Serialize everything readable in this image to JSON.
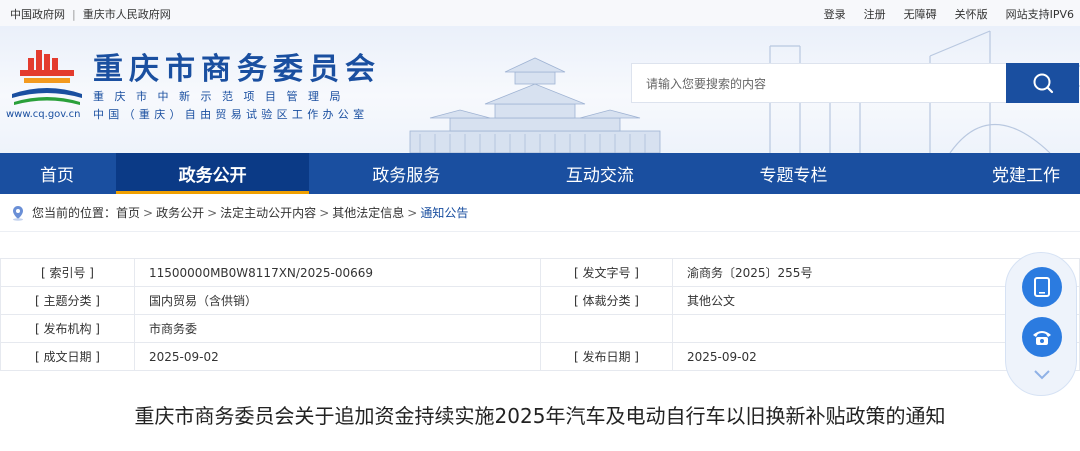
{
  "topbar": {
    "links_left": [
      "中国政府网",
      "重庆市人民政府网"
    ],
    "links_right": [
      "登录",
      "注册",
      "无障碍",
      "关怀版",
      "网站支持IPV6"
    ]
  },
  "header": {
    "site_name": "重庆市商务委员会",
    "subtitle1": "重庆市中新示范项目管理局",
    "subtitle2": "中国（重庆）自由贸易试验区工作办公室",
    "domain": "www.cq.gov.cn"
  },
  "search": {
    "placeholder": "请输入您要搜索的内容"
  },
  "nav": {
    "items": [
      "首页",
      "政务公开",
      "政务服务",
      "互动交流",
      "专题专栏",
      "党建工作"
    ],
    "active_index": 1
  },
  "breadcrumb": {
    "prefix": "您当前的位置：",
    "items": [
      "首页",
      "政务公开",
      "法定主动公开内容",
      "其他法定信息",
      "通知公告"
    ]
  },
  "meta": {
    "rows": [
      {
        "k1": "[ 索引号 ]",
        "v1": "11500000MB0W8117XN/2025-00669",
        "k2": "[ 发文字号 ]",
        "v2": "渝商务〔2025〕255号"
      },
      {
        "k1": "[ 主题分类 ]",
        "v1": "国内贸易（含供销）",
        "k2": "[ 体裁分类 ]",
        "v2": "其他公文"
      },
      {
        "k1": "[ 发布机构 ]",
        "v1": "市商务委",
        "k2": "",
        "v2": ""
      },
      {
        "k1": "[ 成文日期 ]",
        "v1": "2025-09-02",
        "k2": "[ 发布日期 ]",
        "v2": "2025-09-02"
      }
    ]
  },
  "article": {
    "title": "重庆市商务委员会关于追加资金持续实施2025年汽车及电动自行车以旧换新补贴政策的通知"
  },
  "colors": {
    "brand": "#1a4fa0",
    "nav_active": "#0b3a86",
    "accent": "#f0a000"
  },
  "icons": [
    "search-icon",
    "location-pin-icon",
    "tablet-icon",
    "phone-icon",
    "chevron-down-icon"
  ]
}
